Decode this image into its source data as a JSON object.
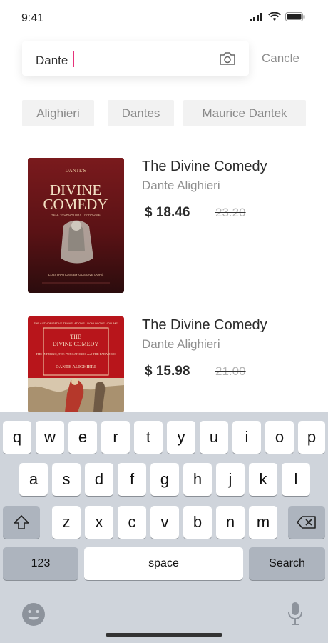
{
  "status": {
    "time": "9:41"
  },
  "search": {
    "value": "Dante",
    "cancel_label": "Cancle"
  },
  "suggestions": [
    "Alighieri",
    "Dantes",
    "Maurice Dantek"
  ],
  "results": [
    {
      "title": "The Divine Comedy",
      "author": "Dante Alighieri",
      "price": "$ 18.46",
      "old_price": "23.20",
      "cover": {
        "top_text": "DANTE'S",
        "big1": "DIVINE",
        "big2": "COMEDY",
        "sub": "HELL · PURGATORY · PARADISE",
        "bottom": "ILLUSTRATIONS BY GUSTAVE DORÉ"
      }
    },
    {
      "title": "The Divine Comedy",
      "author": "Dante Alighieri",
      "price": "$ 15.98",
      "old_price": "21.00",
      "cover": {
        "top_text": "THE AUTHORITATIVE TRANSLATIONS · NOW IN ONE VOLUME",
        "big1": "THE",
        "big2": "DIVINE COMEDY",
        "sub": "THE INFERNO, THE PURGATORIO, and THE PARADISO",
        "bottom": "DANTE ALIGHIERI"
      }
    }
  ],
  "keyboard": {
    "row1": [
      "q",
      "w",
      "e",
      "r",
      "t",
      "y",
      "u",
      "i",
      "o",
      "p"
    ],
    "row2": [
      "a",
      "s",
      "d",
      "f",
      "g",
      "h",
      "j",
      "k",
      "l"
    ],
    "row3": [
      "z",
      "x",
      "c",
      "v",
      "b",
      "n",
      "m"
    ],
    "numbers_label": "123",
    "space_label": "space",
    "search_label": "Search"
  },
  "colors": {
    "cursor": "#e6327a",
    "keyboard_bg": "#cfd4db"
  }
}
